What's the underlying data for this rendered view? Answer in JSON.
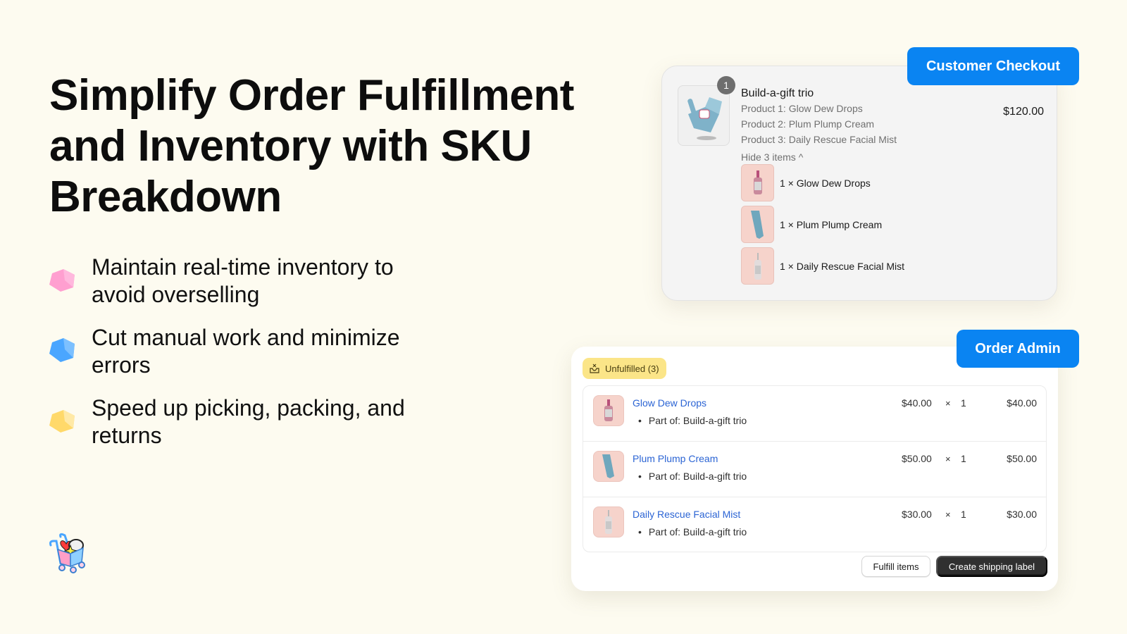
{
  "headline": "Simplify Order Fulfillment and Inventory with SKU Breakdown",
  "features": [
    {
      "text": "Maintain real-time inventory to avoid overselling",
      "icon": "pink-cube-icon",
      "color": "#ff9fd0"
    },
    {
      "text": "Cut manual work and minimize errors",
      "icon": "blue-cube-icon",
      "color": "#4aa6ff"
    },
    {
      "text": "Speed up picking, packing, and returns",
      "icon": "yellow-cube-icon",
      "color": "#ffd96a"
    }
  ],
  "tags": {
    "checkout": "Customer Checkout",
    "admin": "Order Admin"
  },
  "checkout": {
    "quantity_badge": "1",
    "bundle_title": "Build-a-gift trio",
    "lines": [
      "Product 1: Glow Dew Drops",
      "Product 2: Plum Plump Cream",
      "Product 3: Daily Rescue Facial Mist"
    ],
    "price": "$120.00",
    "toggle_label": "Hide 3 items ^",
    "sub_items": [
      "1 × Glow Dew Drops",
      "1 × Plum Plump Cream",
      "1 × Daily Rescue Facial Mist"
    ]
  },
  "admin": {
    "status_badge": "Unfulfilled (3)",
    "rows": [
      {
        "name": "Glow Dew Drops",
        "part_of": "Part of: Build-a-gift trio",
        "unit_price": "$40.00",
        "times": "×",
        "qty": "1",
        "total": "$40.00"
      },
      {
        "name": "Plum Plump Cream",
        "part_of": "Part of: Build-a-gift trio",
        "unit_price": "$50.00",
        "times": "×",
        "qty": "1",
        "total": "$50.00"
      },
      {
        "name": "Daily Rescue Facial Mist",
        "part_of": "Part of: Build-a-gift trio",
        "unit_price": "$30.00",
        "times": "×",
        "qty": "1",
        "total": "$30.00"
      }
    ],
    "fulfill_button": "Fulfill items",
    "shipping_button": "Create shipping label"
  },
  "colors": {
    "background": "#fdfbf0",
    "accent_blue": "#0a84f2",
    "link_blue": "#2b64d4",
    "badge_yellow": "#fbe588",
    "primary_button": "#303030"
  }
}
